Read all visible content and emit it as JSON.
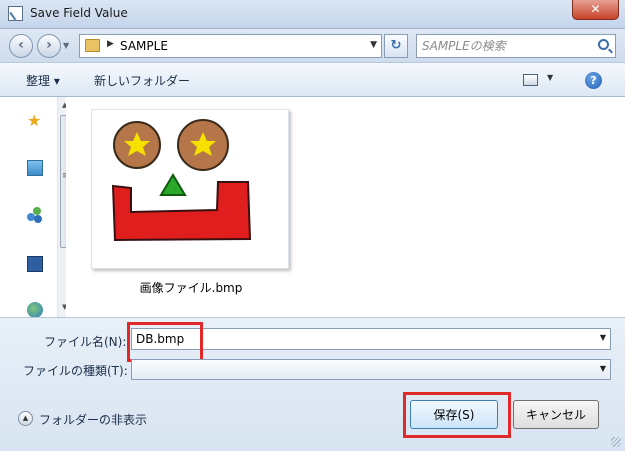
{
  "window": {
    "title": "Save Field Value",
    "close_label": "✕"
  },
  "address": {
    "folder": "SAMPLE",
    "search_placeholder": "SAMPLEの検索"
  },
  "toolbar": {
    "organize_label": "整理 ▾",
    "new_folder_label": "新しいフォルダー"
  },
  "files": [
    {
      "name": "画像ファイル.bmp"
    }
  ],
  "thumbnail": {
    "eye_color": "#b5764a",
    "star_color": "#f5e000",
    "nose_color": "#2aa82a",
    "mouth_color": "#e01e1e"
  },
  "form": {
    "filename_label": "ファイル名(N):",
    "filename_value": "DB.bmp",
    "filetype_label": "ファイルの種類(T):",
    "filetype_value": ""
  },
  "footer": {
    "hide_folders_label": "フォルダーの非表示",
    "save_label": "保存(S)",
    "cancel_label": "キャンセル"
  },
  "highlight_color": "#e02a2a"
}
